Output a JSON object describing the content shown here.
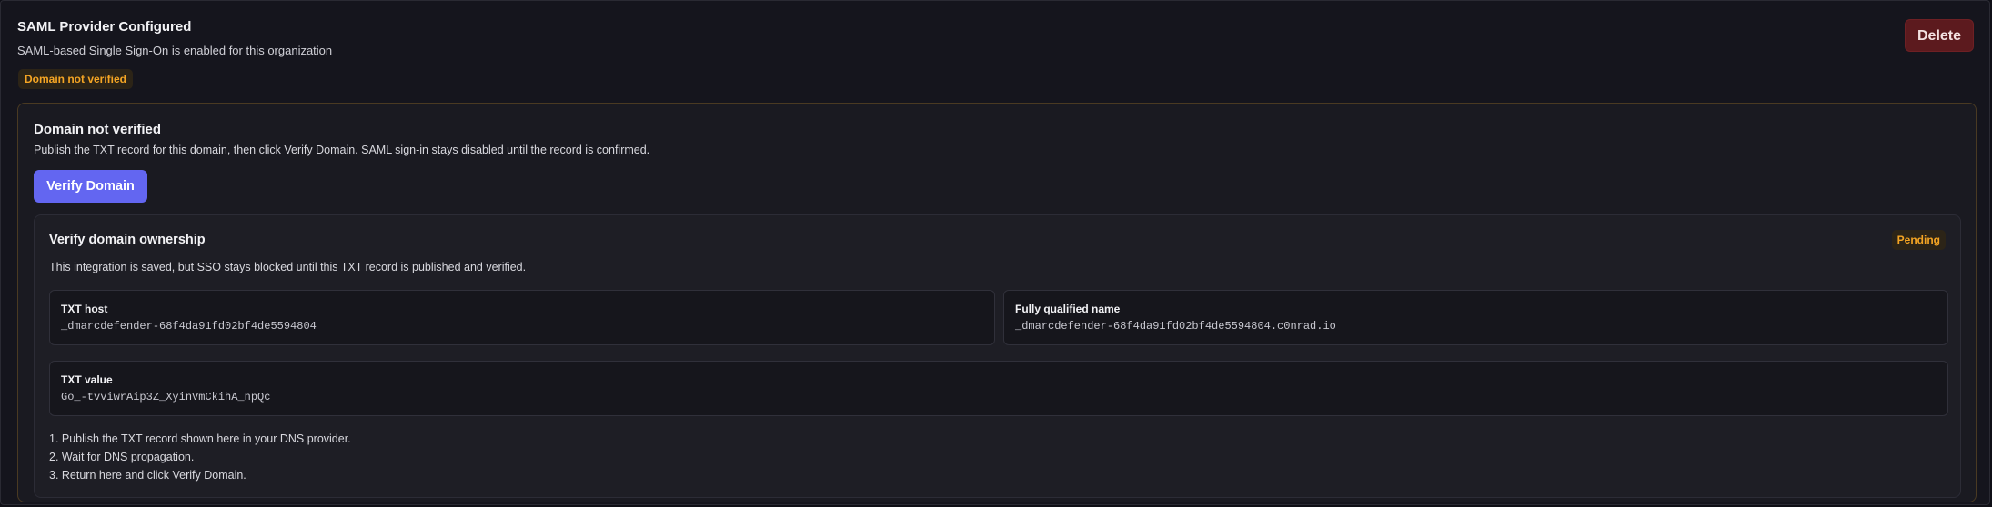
{
  "header": {
    "title": "SAML Provider Configured",
    "subtitle": "SAML-based Single Sign-On is enabled for this organization",
    "status_badge": "Domain not verified",
    "delete_label": "Delete"
  },
  "warning": {
    "title": "Domain not verified",
    "description": "Publish the TXT record for this domain, then click Verify Domain. SAML sign-in stays disabled until the record is confirmed.",
    "verify_button": "Verify Domain"
  },
  "ownership": {
    "title": "Verify domain ownership",
    "status": "Pending",
    "description": "This integration is saved, but SSO stays blocked until this TXT record is published and verified.",
    "txt_host": {
      "label": "TXT host",
      "value": "_dmarcdefender-68f4da91fd02bf4de5594804"
    },
    "fqdn": {
      "label": "Fully qualified name",
      "value": "_dmarcdefender-68f4da91fd02bf4de5594804.c0nrad.io"
    },
    "txt_value": {
      "label": "TXT value",
      "value": "Go_-tvviwrAip3Z_XyinVmCkihA_npQc"
    },
    "steps": [
      "1. Publish the TXT record shown here in your DNS provider.",
      "2. Wait for DNS propagation.",
      "3. Return here and click Verify Domain."
    ]
  },
  "colors": {
    "background": "#15151d",
    "warning_accent": "#f5a524",
    "primary_button": "#6363f1",
    "danger_button": "#5c1a1e"
  }
}
